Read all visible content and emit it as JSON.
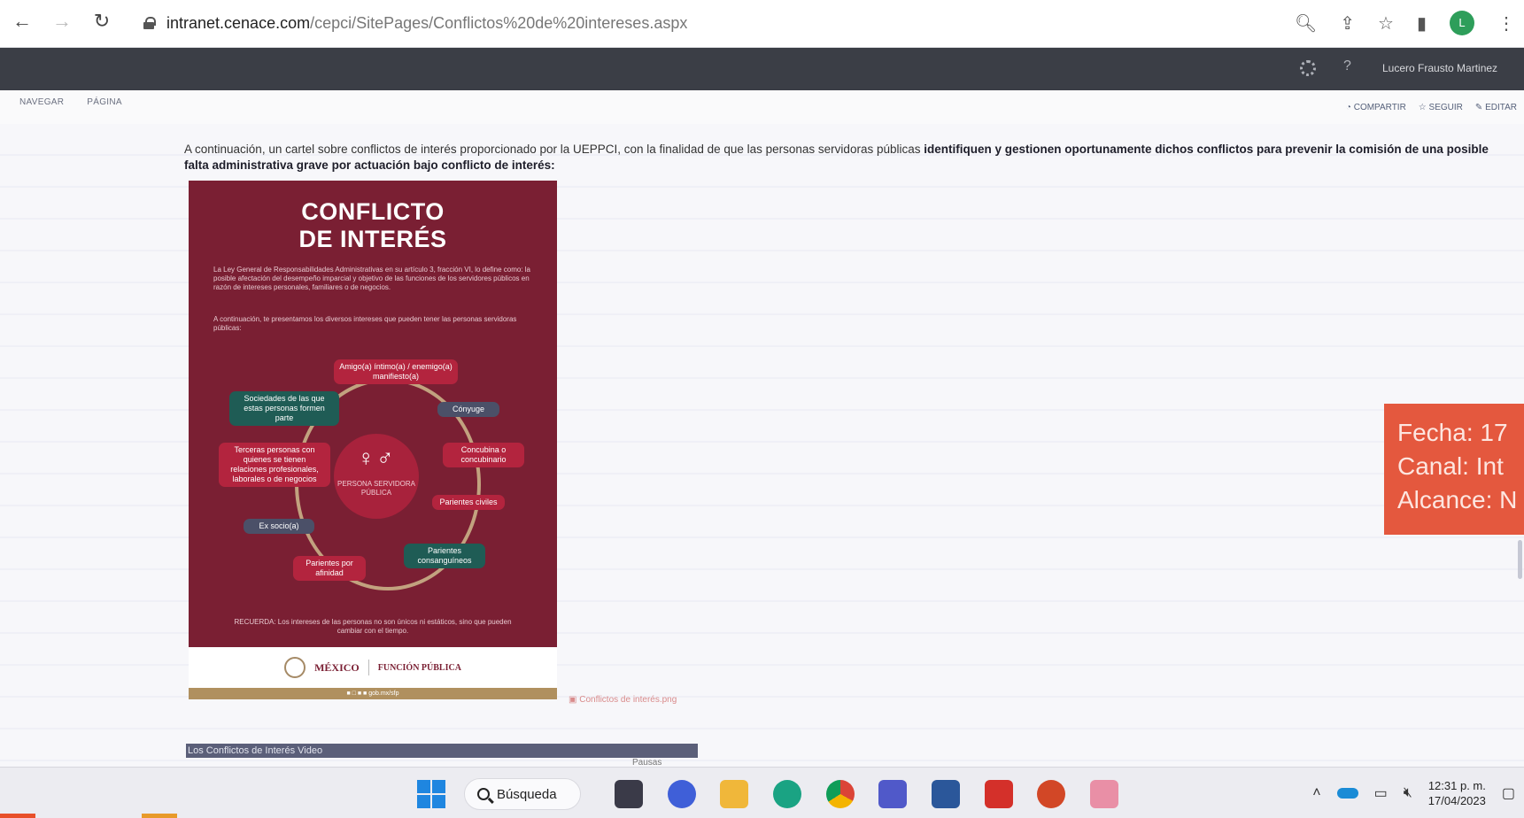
{
  "browser": {
    "url_host": "intranet.cenace.com",
    "url_path": "/cepci/SitePages/Conflictos%20de%20intereses.aspx",
    "profile_initial": "L"
  },
  "suitebar": {
    "user_name": "Lucero Frausto Martinez",
    "help_label": "?"
  },
  "commands": {
    "left": [
      "NAVEGAR",
      "PÁGINA"
    ],
    "right": [
      "COMPARTIR",
      "SEGUIR",
      "EDITAR"
    ]
  },
  "intro": {
    "normal": "A continuación, un cartel sobre conflictos de interés proporcionado por la UEPPCI, con la finalidad de que las personas servidoras públicas ",
    "bold": "identifiquen y gestionen oportunamente dichos conflictos para prevenir la comisión de una posible falta administrativa grave por actuación bajo conflicto de interés:"
  },
  "poster": {
    "title_line1": "CONFLICTO",
    "title_line2": "DE INTERÉS",
    "paragraph1": "La Ley General de Responsabilidades Administrativas en su artículo 3, fracción VI, lo define como: la posible afectación del desempeño imparcial y objetivo de las funciones de los servidores públicos en razón de intereses personales, familiares o de negocios.",
    "paragraph2": "A continuación, te presentamos los diversos intereses que pueden tener las personas servidoras públicas:",
    "center_label": "PERSONA SERVIDORA PÚBLICA",
    "nodes": {
      "amistad": "Amigo(a) íntimo(a) / enemigo(a) manifiesto(a)",
      "conyuge": "Cónyuge",
      "concubina": "Concubina o concubinario",
      "civiles": "Parientes civiles",
      "consanguineos": "Parientes consanguíneos",
      "afinidad": "Parientes por afinidad",
      "exsocio": "Ex socio(a)",
      "terceros": "Terceras personas con quienes se tienen relaciones profesionales, laborales o de negocios",
      "sociedades": "Sociedades de las que estas personas formen parte"
    },
    "footer_note": "RECUERDA: Los intereses de las personas no son únicos ni estáticos, sino que pueden cambiar con el tiempo.",
    "gov_brand": "MÉXICO",
    "gov_dependency": "FUNCIÓN PÚBLICA",
    "strip_text": "■ □ ■ ■ gob.mx/sfp"
  },
  "image_caption": "Conflictos de interés.png",
  "video": {
    "title": "Los Conflictos de Interés Video",
    "sub": "Pausas"
  },
  "stamp": {
    "line1": "Fecha: 17",
    "line2": "Canal: Int",
    "line3": "Alcance: N"
  },
  "taskbar": {
    "search_label": "Búsqueda",
    "time": "12:31 p. m.",
    "date": "17/04/2023"
  },
  "colors": {
    "poster_bg": "#7a1f33",
    "suitebar": "#3b3e46",
    "stamp": "#e4583e"
  }
}
